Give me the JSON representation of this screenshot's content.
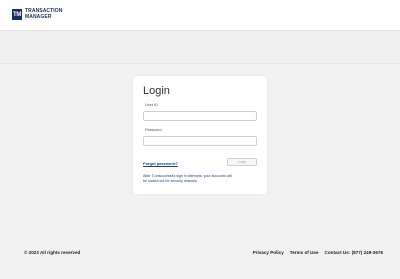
{
  "header": {
    "logo_mark": "TM",
    "logo_line1": "TRANSACTION",
    "logo_line2": "MANAGER"
  },
  "login": {
    "title": "Login",
    "user_id_label": "User ID",
    "password_label": "Password",
    "forgot_password": "Forgot password?",
    "login_button": "Login",
    "warning": "After 3 unsuccessful sign in attempts, your accounts will be locked out for security reasons."
  },
  "footer": {
    "copyright": "© 2022 All rights reserved",
    "links": [
      "Privacy Policy",
      "Terms of Use",
      "Contact Us: (877) 249-3676"
    ]
  }
}
